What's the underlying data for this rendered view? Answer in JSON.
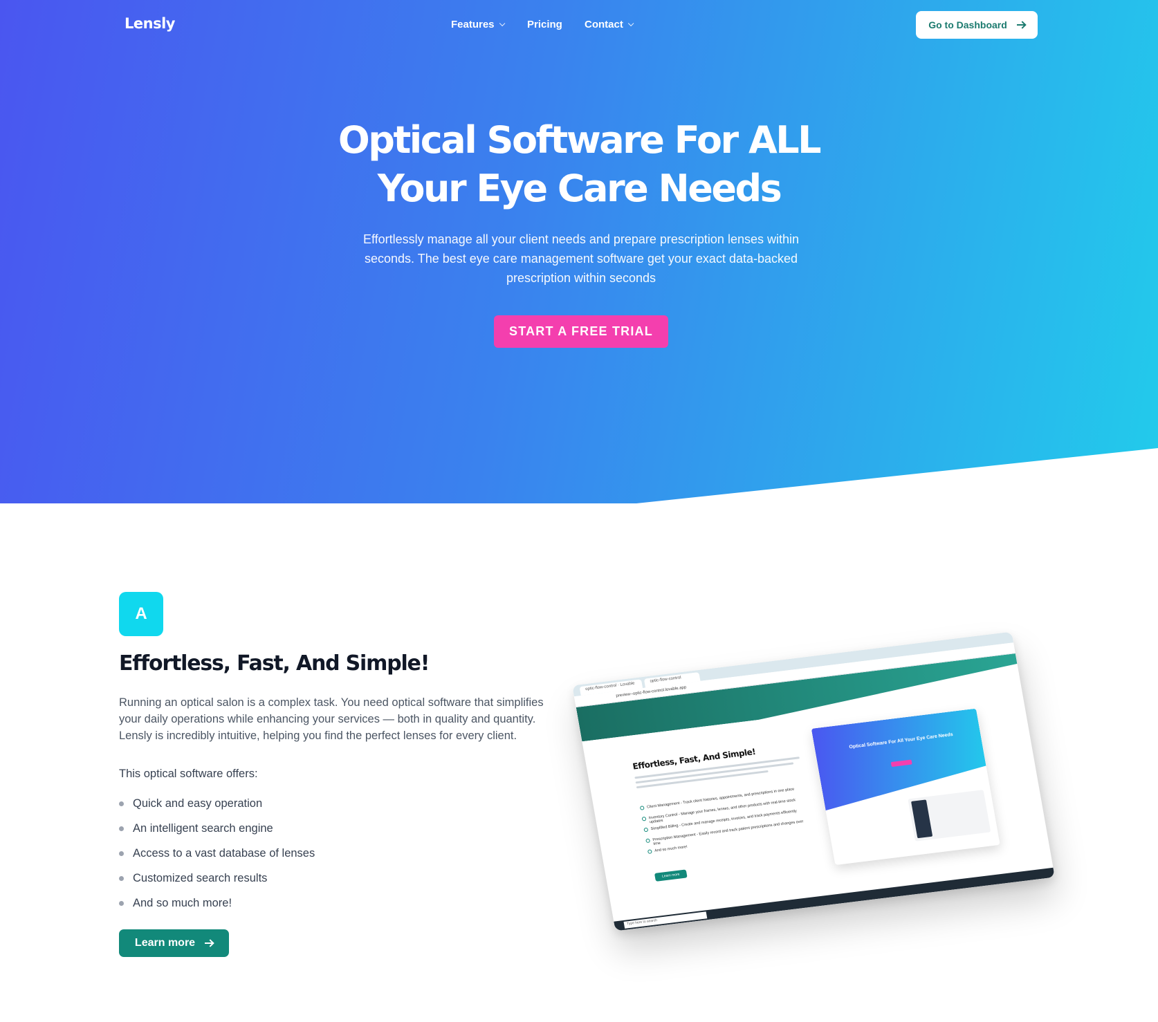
{
  "nav": {
    "logo": "Lensly",
    "links": [
      {
        "label": "Features",
        "has_dropdown": true
      },
      {
        "label": "Pricing",
        "has_dropdown": false
      },
      {
        "label": "Contact",
        "has_dropdown": true
      }
    ],
    "dashboard_button": "Go to Dashboard"
  },
  "hero": {
    "title": "Optical Software For ALL Your Eye Care Needs",
    "subtitle": "Effortlessly manage all your client needs and prepare prescription lenses within seconds. The best eye care management software get your exact data-backed prescription within seconds",
    "cta": "START A FREE TRIAL"
  },
  "feature": {
    "badge": "A",
    "title": "Effortless, Fast, And Simple!",
    "paragraph": "Running an optical salon is a complex task. You need optical software that simplifies your daily operations while enhancing your services — both in quality and quantity. Lensly is incredibly intuitive, helping you find the perfect lenses for every client.",
    "offers_intro": "This optical software offers:",
    "bullets": [
      "Quick and easy operation",
      "An intelligent search engine",
      "Access to a vast database of lenses",
      "Customized search results",
      "And so much more!"
    ],
    "learn_more": "Learn more"
  },
  "mockup": {
    "tab_1": "optic-flow-control · Lovable",
    "tab_2": "optic-flow-control",
    "url": "preview--optic-flow-control.lovable.app",
    "heading": "Effortless, Fast, And Simple!",
    "list": [
      "Client Management - Track client histories, appointments, and prescriptions in one place",
      "Inventory Control - Manage your frames, lenses, and other products with real-time stock updates",
      "Simplified Billing - Create and manage receipts, invoices, and track payments efficiently",
      "Prescription Management - Easily record and track patient prescriptions and changes over time",
      "And so much more!"
    ],
    "button": "Learn more",
    "inner_title": "Optical Software For All Your Eye Care Needs",
    "taskbar_search": "Type here to search"
  },
  "colors": {
    "hero_gradient_start": "#4a56f0",
    "hero_gradient_end": "#22cbeb",
    "cta": "#f43fae",
    "teal": "#12897a",
    "badge": "#10d8ee"
  }
}
